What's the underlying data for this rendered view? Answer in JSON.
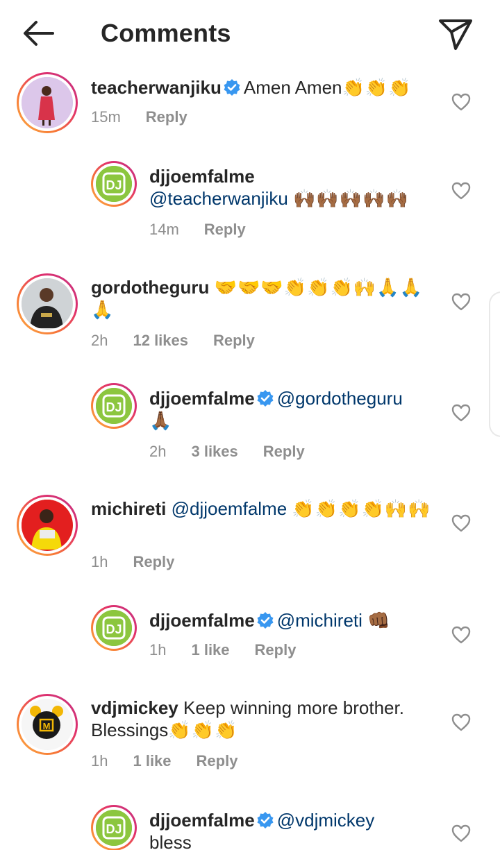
{
  "header": {
    "title": "Comments",
    "back_icon": "arrow-left-icon",
    "share_icon": "paper-plane-icon"
  },
  "comments": [
    {
      "username": "teacherwanjiku",
      "verified": true,
      "text": "Amen Amen",
      "emoji": "👏👏👏",
      "mention": "",
      "time": "15m",
      "likes": "",
      "reply": "Reply"
    },
    {
      "username": "djjoemfalme",
      "verified": false,
      "mention": "@teacherwanjiku",
      "text": "",
      "emoji": "🙌🏾🙌🏾🙌🏾🙌🏾🙌🏾",
      "time": "14m",
      "likes": "",
      "reply": "Reply"
    },
    {
      "username": "gordotheguru",
      "verified": false,
      "text": "",
      "emoji": "🤝🤝🤝👏👏👏🙌🙏🙏🙏",
      "mention": "",
      "time": "2h",
      "likes": "12 likes",
      "reply": "Reply"
    },
    {
      "username": "djjoemfalme",
      "verified": true,
      "mention": "@gordotheguru",
      "text": "",
      "emoji": "🙏🏾",
      "time": "2h",
      "likes": "3 likes",
      "reply": "Reply"
    },
    {
      "username": "michireti",
      "verified": false,
      "mention": "@djjoemfalme",
      "text": "",
      "emoji": "👏👏👏👏🙌🙌",
      "time": "1h",
      "likes": "",
      "reply": "Reply"
    },
    {
      "username": "djjoemfalme",
      "verified": true,
      "mention": "@michireti",
      "text": "",
      "emoji": "👊🏾",
      "time": "1h",
      "likes": "1 like",
      "reply": "Reply"
    },
    {
      "username": "vdjmickey",
      "verified": false,
      "text": "Keep winning more brother. Blessings",
      "emoji": "👏👏👏",
      "mention": "",
      "time": "1h",
      "likes": "1 like",
      "reply": "Reply"
    },
    {
      "username": "djjoemfalme",
      "verified": true,
      "mention": "@vdjmickey",
      "text": "bless",
      "emoji": "",
      "time": "",
      "likes": "",
      "reply": ""
    }
  ],
  "colors": {
    "verified": "#3897f0",
    "mention": "#00376b",
    "meta": "#8e8e8e",
    "dj_green": "#8cc63f"
  }
}
